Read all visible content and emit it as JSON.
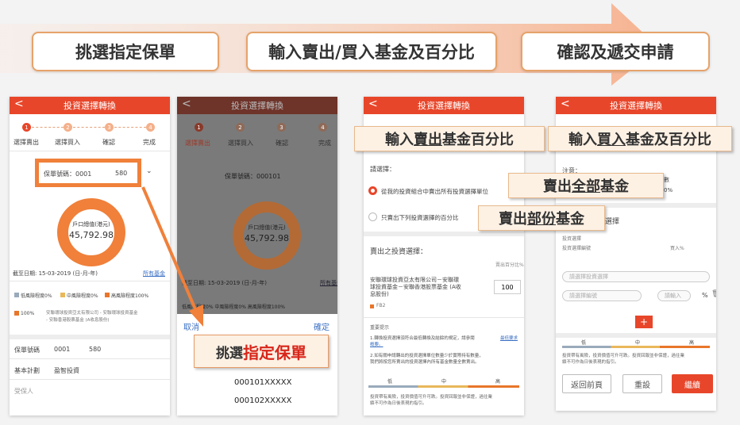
{
  "steps": [
    "挑選指定保單",
    "輸入賣出/買入基金及百分比",
    "確認及遞交申請"
  ],
  "app": {
    "title": "投資選擇轉換",
    "back": "<"
  },
  "wizard": {
    "s1": "選擇賣出",
    "s2": "選擇買入",
    "s3": "確認",
    "s4": "完成"
  },
  "p1": {
    "policy_label": "保單號碼：0001",
    "policy_suffix": "580",
    "ring_label": "戶口總值(港元)",
    "ring_value": "45,792.98",
    "date": "截至日期: 15-03-2019 (日-月-年)",
    "all_funds": "所有基金",
    "legend_low": "低風險程度0%",
    "legend_mid": "中風險程度0%",
    "legend_high": "高風險程度100%",
    "pct": "100%",
    "fund_line1": "安聯環球投資亞太有限公司 - 安聯環球投資基金",
    "fund_line2": "- 安聯香港股票基金 (A收息股份)",
    "row1_label": "保單號碼",
    "row1_a": "0001",
    "row1_b": "580",
    "row2_label": "基本計劃",
    "row2_value": "盈智投資",
    "row3_label": "受保人"
  },
  "p2": {
    "policy_label": "保單號碼：000101",
    "date": "截至日期: 15-03-2019 (日-月-年)",
    "all_funds": "所有基金",
    "legend": "低風險程度0%  中風險程度0%  高風險程度100%",
    "cancel": "取消",
    "confirm": "確定",
    "opt1": "000101XXXXX",
    "opt2": "000102XXXXX"
  },
  "p3": {
    "choose": "請選擇：",
    "radio1": "從我的投資組合中賣出所有投資選擇單位",
    "radio2": "只賣出下列投資選擇的百分比",
    "sell_title": "賣出之投資選擇：",
    "sell_pct_label": "賣出百分比%",
    "fund_line1": "安聯環球投資亞太有限公司－安聯環",
    "fund_line2": "球投資基金－安聯香港股票基金 (A收",
    "fund_line3": "息股份)",
    "fund_code": "FB2",
    "pct_value": "100",
    "notice_title": "重要提示",
    "notice1a": "1.轉換投資選擇須符合最低轉換及結餘的規定，請參閱",
    "notice1_link": "最低要求",
    "notice1b": "概要。",
    "notice2a": "2.如有關申請轉出的投資選擇單位數量少於實際持有數量，",
    "notice2b": "我們將按您所賣出的投資選擇內所有基金數量全數賣出。",
    "risk_low": "低",
    "risk_mid": "中",
    "risk_high": "高",
    "risk_note1": "投資帶有風險，投資價值可升可跌。投資回報並非保證，過往業",
    "risk_note2": "績不可作為日後表現的指引。"
  },
  "p4": {
    "note": "注意：",
    "note_r1": "數",
    "note_r2": "0%",
    "buy_title": "選擇",
    "fund_hdr": "投資選擇",
    "col1": "投資選擇編號",
    "col2": "買入%",
    "select_placeholder": "請選擇投資選擇",
    "code_placeholder": "請選擇編號",
    "pct_placeholder": "請輸入",
    "pct_sign": "%",
    "add": "+",
    "risk_low": "低",
    "risk_mid": "中",
    "risk_high": "高",
    "risk_note1": "投資帶有風險，投資價值可升可跌。投資回報並非保證，過往業",
    "risk_note2": "績不可作為日後表現的指引。",
    "btn_back": "返回前頁",
    "btn_reset": "重設",
    "btn_next": "繼續"
  },
  "callouts": {
    "sell_pct_pre": "輸入",
    "sell_pct_u": "賣出",
    "sell_pct_post": "基金百分比",
    "buy_pre": "輸入",
    "buy_u": "買入",
    "buy_post": "基金及百分比",
    "sell_all_pre": "賣出",
    "sell_all_u": "全部",
    "sell_all_post": "基金",
    "sell_part_pre": "賣出",
    "sell_part_u": "部份",
    "sell_part_post": "基金",
    "pick_pre": "挑選",
    "pick_hl": "指定保單"
  },
  "colors": {
    "brand_red": "#e8462a",
    "ring_orange": "#f0803a",
    "callout_bg": "#fdf1e4",
    "step_border": "#e6a36a"
  }
}
